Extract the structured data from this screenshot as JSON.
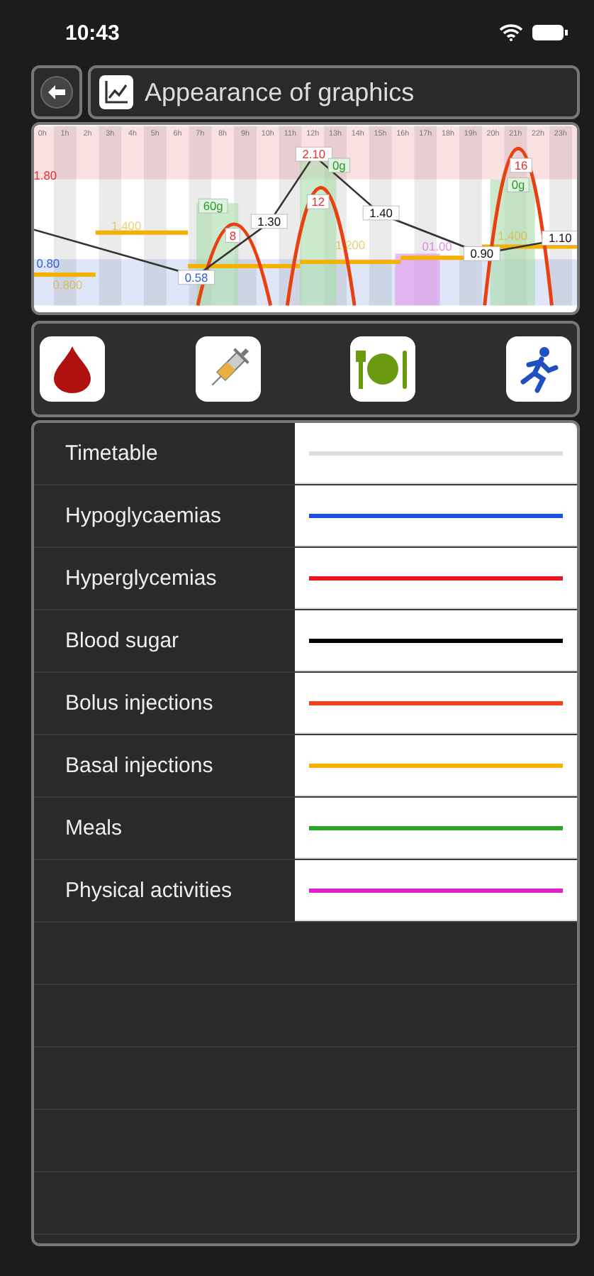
{
  "status_bar": {
    "time": "10:43"
  },
  "header": {
    "title": "Appearance of graphics"
  },
  "chart": {
    "hours": [
      "0h",
      "1h",
      "2h",
      "3h",
      "4h",
      "5h",
      "6h",
      "7h",
      "8h",
      "9h",
      "10h",
      "11h",
      "12h",
      "13h",
      "14h",
      "15h",
      "16h",
      "17h",
      "18h",
      "19h",
      "20h",
      "21h",
      "22h",
      "23h"
    ],
    "labels": [
      {
        "text": "1.80",
        "kind": "limit-high"
      },
      {
        "text": "0.80",
        "kind": "limit-low"
      },
      {
        "text": "0.800",
        "kind": "basal"
      },
      {
        "text": "1.400",
        "kind": "basal"
      },
      {
        "text": "60g",
        "kind": "meal"
      },
      {
        "text": "8",
        "kind": "bolus"
      },
      {
        "text": "1.30",
        "kind": "glucose"
      },
      {
        "text": "0.58",
        "kind": "glucose-low"
      },
      {
        "text": "2.10",
        "kind": "glucose-high"
      },
      {
        "text": "0g",
        "kind": "meal"
      },
      {
        "text": "12",
        "kind": "bolus"
      },
      {
        "text": "1.40",
        "kind": "glucose"
      },
      {
        "text": "1.200",
        "kind": "basal"
      },
      {
        "text": "01.00",
        "kind": "activity"
      },
      {
        "text": "0.90",
        "kind": "glucose"
      },
      {
        "text": "16",
        "kind": "bolus"
      },
      {
        "text": "0g",
        "kind": "meal"
      },
      {
        "text": "1.400",
        "kind": "basal"
      },
      {
        "text": "1.10",
        "kind": "glucose"
      }
    ]
  },
  "categories": [
    {
      "kind": "blood"
    },
    {
      "kind": "injection"
    },
    {
      "kind": "meal"
    },
    {
      "kind": "activity"
    }
  ],
  "legend": [
    {
      "label": "Timetable",
      "color": "#dddddd"
    },
    {
      "label": "Hypoglycaemias",
      "color": "#1a4fe0"
    },
    {
      "label": "Hyperglycemias",
      "color": "#e8141e"
    },
    {
      "label": "Blood sugar",
      "color": "#000000"
    },
    {
      "label": "Bolus injections",
      "color": "#f0401c"
    },
    {
      "label": "Basal injections",
      "color": "#f5b000"
    },
    {
      "label": "Meals",
      "color": "#2aa52a"
    },
    {
      "label": "Physical activities",
      "color": "#e020d0"
    }
  ]
}
